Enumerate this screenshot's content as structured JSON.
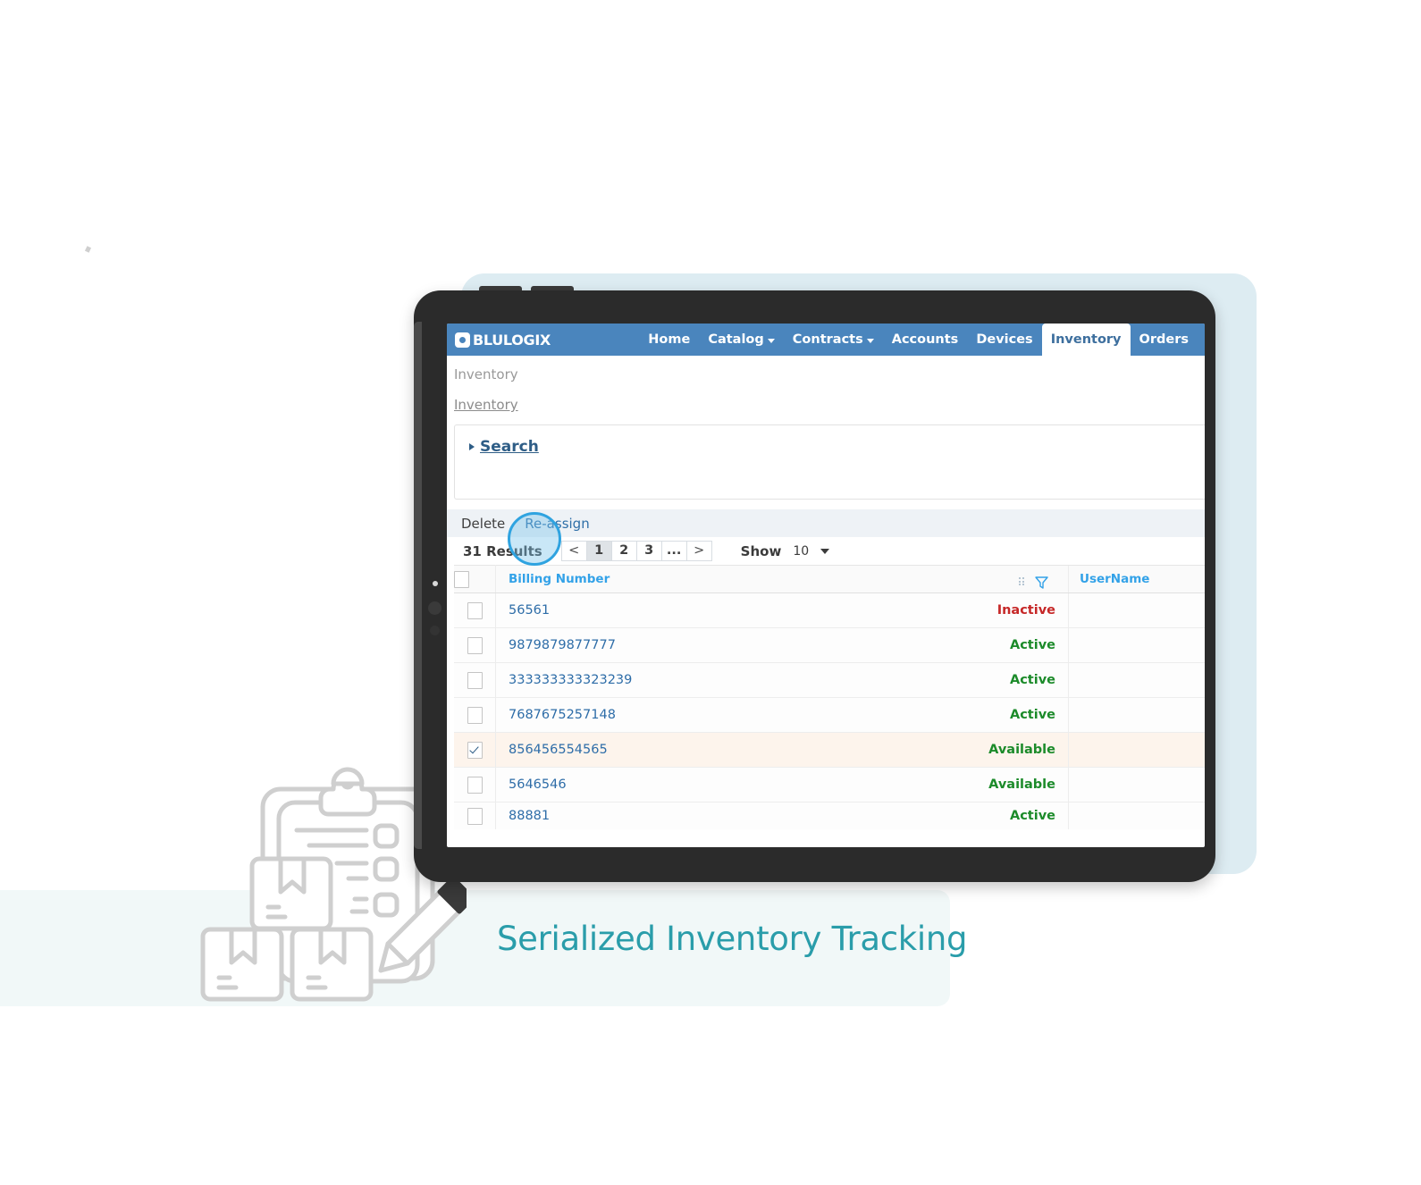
{
  "caption": "Serialized Inventory Tracking",
  "app": {
    "brand": "BLULOGIX",
    "nav": [
      {
        "label": "Home",
        "has_caret": false,
        "active": false
      },
      {
        "label": "Catalog",
        "has_caret": true,
        "active": false
      },
      {
        "label": "Contracts",
        "has_caret": true,
        "active": false
      },
      {
        "label": "Accounts",
        "has_caret": false,
        "active": false
      },
      {
        "label": "Devices",
        "has_caret": false,
        "active": false
      },
      {
        "label": "Inventory",
        "has_caret": false,
        "active": true
      },
      {
        "label": "Orders",
        "has_caret": false,
        "active": false
      }
    ],
    "breadcrumb": {
      "title": "Inventory",
      "link": "Inventory"
    },
    "search_panel": {
      "label": "Search",
      "expanded": false
    },
    "toolbar": {
      "delete_label": "Delete",
      "reassign_label": "Re-assign"
    },
    "pagination": {
      "results": "31 Results",
      "prev": "<",
      "next": ">",
      "pages": [
        "1",
        "2",
        "3",
        "..."
      ],
      "current_page": "1",
      "show_label": "Show",
      "show_value": "10"
    },
    "table": {
      "columns": [
        {
          "key": "check",
          "label": ""
        },
        {
          "key": "billing",
          "label": "Billing Number"
        },
        {
          "key": "status",
          "label": ""
        },
        {
          "key": "user",
          "label": "UserName"
        }
      ],
      "rows": [
        {
          "checked": false,
          "billing": "56561",
          "status": "Inactive",
          "status_kind": "inactive",
          "user": ""
        },
        {
          "checked": false,
          "billing": "9879879877777",
          "status": "Active",
          "status_kind": "active",
          "user": ""
        },
        {
          "checked": false,
          "billing": "333333333323239",
          "status": "Active",
          "status_kind": "active",
          "user": ""
        },
        {
          "checked": false,
          "billing": "7687675257148",
          "status": "Active",
          "status_kind": "active",
          "user": ""
        },
        {
          "checked": true,
          "billing": "856456554565",
          "status": "Available",
          "status_kind": "available",
          "user": ""
        },
        {
          "checked": false,
          "billing": "5646546",
          "status": "Available",
          "status_kind": "available",
          "user": ""
        },
        {
          "checked": false,
          "billing": "88881",
          "status": "Active",
          "status_kind": "active",
          "user": ""
        }
      ]
    }
  },
  "colors": {
    "nav_blue": "#4a85bd",
    "link_blue": "#2e6da8",
    "header_blue": "#33a2e8",
    "active_green": "#1c8b2a",
    "inactive_red": "#c62828",
    "selected_row": "#fdf4ec",
    "caption_teal": "#2a9daa",
    "mint_band": "#f1f8f8",
    "tablet_body": "#2b2b2b",
    "tablet_shadow": "#ddecf2",
    "focus_ring": "#2fa3e0"
  }
}
